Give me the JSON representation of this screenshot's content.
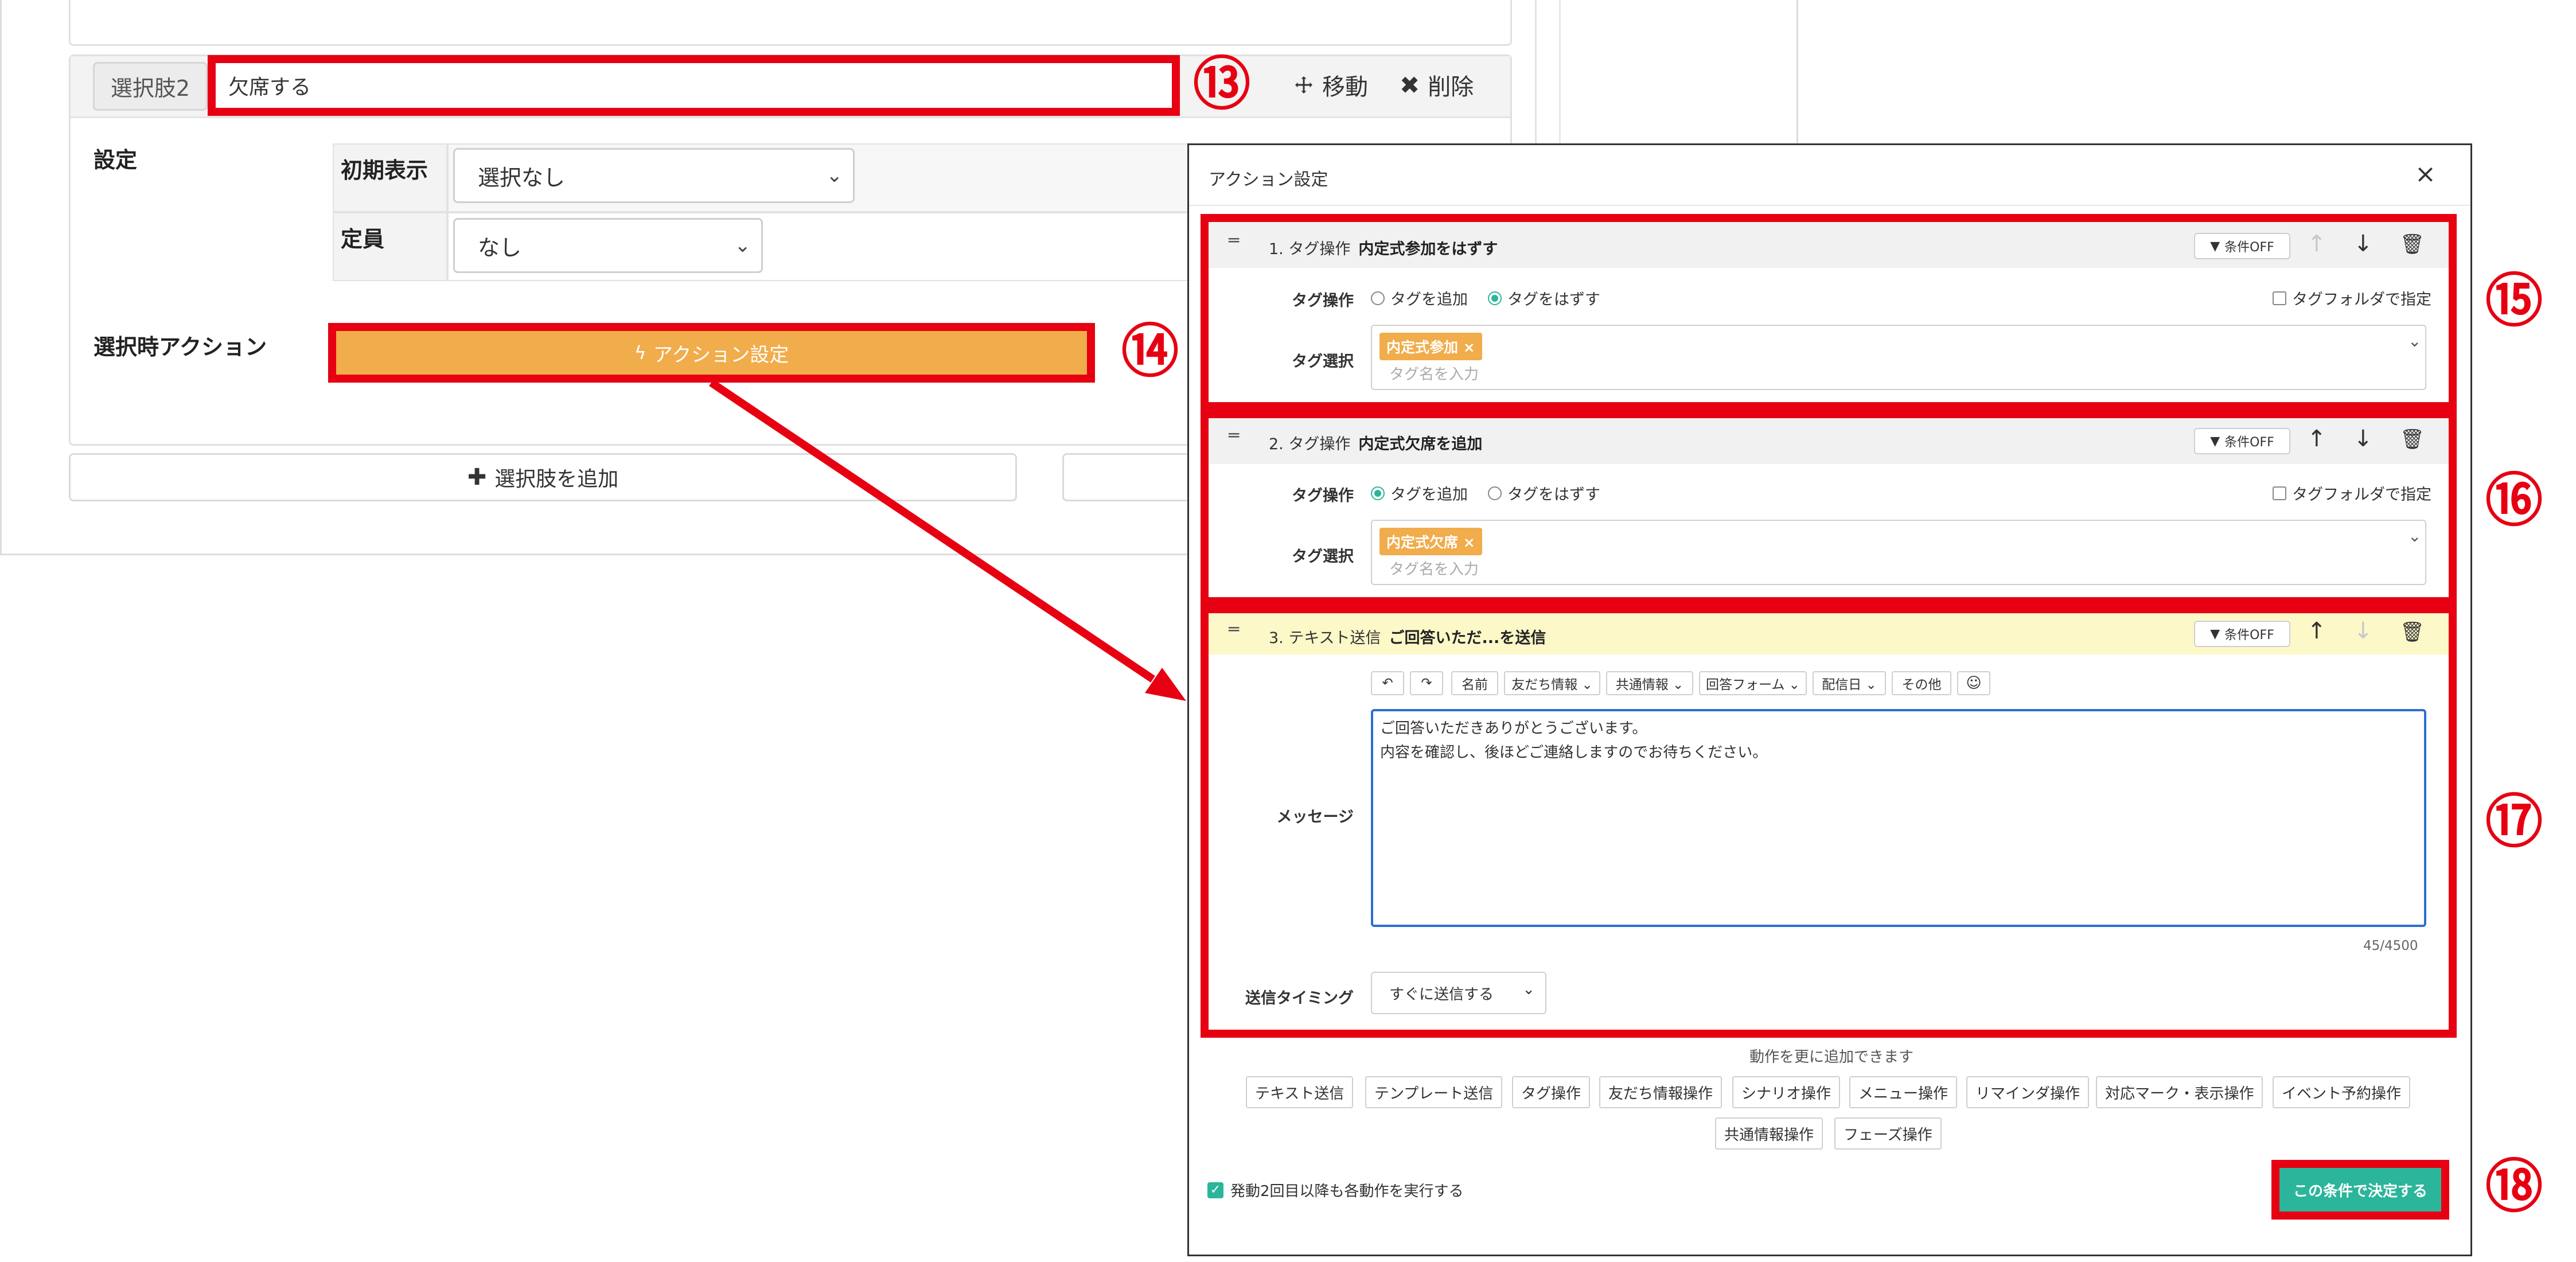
{
  "choice": {
    "badge_label": "選択肢2",
    "input_value": "欠席する",
    "move_label": "移動",
    "delete_label": "削除"
  },
  "settings": {
    "section_label": "設定",
    "initial_display_label": "初期表示",
    "initial_display_value": "選択なし",
    "capacity_label": "定員",
    "capacity_value": "なし"
  },
  "action": {
    "section_label": "選択時アクション",
    "button_label": "アクション設定"
  },
  "add_choice_label": "選択肢を追加",
  "callouts": {
    "n13": "⑬",
    "n14": "⑭",
    "n15": "⑮",
    "n16": "⑯",
    "n17": "⑰",
    "n18": "⑱"
  },
  "modal": {
    "title": "アクション設定",
    "close": "×",
    "condition_off": "条件OFF",
    "tag_op_label": "タグ操作",
    "tag_select_label": "タグ選択",
    "radio_add": "タグを追加",
    "radio_remove": "タグをはずす",
    "folder_label": "タグフォルダで指定",
    "tag_placeholder": "タグ名を入力",
    "block1": {
      "title": "1. タグ操作",
      "title_bold": "内定式参加をはずす",
      "tag": "内定式参加 ×"
    },
    "block2": {
      "title": "2. タグ操作",
      "title_bold": "内定式欠席を追加",
      "tag": "内定式欠席 ×"
    },
    "block3": {
      "title": "3. テキスト送信",
      "title_bold": "ご回答いただ...を送信",
      "toolbar": [
        "↶",
        "↷",
        "名前",
        "友だち情報 ⌄",
        "共通情報 ⌄",
        "回答フォーム ⌄",
        "配信日 ⌄",
        "その他"
      ],
      "message_label": "メッセージ",
      "message_line1": "ご回答いただきありがとうございます。",
      "message_line2": "内容を確認し、後ほどご連絡しますのでお待ちください。",
      "char_count": "45/4500",
      "timing_label": "送信タイミング",
      "timing_value": "すぐに送信する"
    },
    "add_more_label": "動作を更に追加できます",
    "add_buttons_row1": [
      "テキスト送信",
      "テンプレート送信",
      "タグ操作",
      "友だち情報操作",
      "シナリオ操作",
      "メニュー操作",
      "リマインダ操作",
      "対応マーク・表示操作",
      "イベント予約操作"
    ],
    "add_buttons_row2": [
      "共通情報操作",
      "フェーズ操作"
    ],
    "repeat_label": "発動2回目以降も各動作を実行する",
    "decide_label": "この条件で決定する"
  },
  "colors": {
    "accent_red": "#e60012",
    "action_orange": "#f1ac4b",
    "teal": "#2bb59a",
    "focus_blue": "#2c6fd0",
    "highlight_yellow": "#fdf8c8"
  }
}
